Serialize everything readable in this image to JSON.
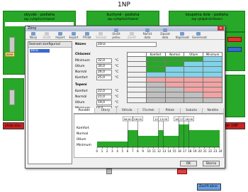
{
  "page_title": "1NP",
  "rooms": [
    {
      "title": "obyvák - podlaha",
      "status": "zap vytápění/chlazení",
      "state": "Normal"
    },
    {
      "title": "kuchyně - podlaha",
      "status": "zap vytápění/chlazení",
      "state": "Normal"
    },
    {
      "title": "koupelna dole - podlaha",
      "status": "zap vytápění/chlazení",
      "state": "Normal"
    }
  ],
  "room_button_label": "zone",
  "side_button": "program 1NP",
  "bottom_buttons": [
    "přidat zónu",
    "Zavřít okno"
  ],
  "dialog": {
    "title": "Zóny",
    "toolbar": [
      "Nový",
      "Uložit",
      "Import",
      "Export",
      "Přidat",
      "Smazat",
      "Uložit jednu",
      "Zavřít",
      "Načíst data",
      "Zapsat data",
      "Kopírovat",
      "Generovat"
    ],
    "list_header": "Seznam konfigurací",
    "list_item": "zóna",
    "name_label": "Název",
    "name_value": "zóna",
    "cooling_label": "Chlazení",
    "heating_label": "Topení",
    "fields": [
      "Minimum",
      "Útlum",
      "Normál",
      "Komfort"
    ],
    "cooling_values": [
      "32,0",
      "30,0",
      "26,0",
      "25,0"
    ],
    "heating_values": [
      "22,0",
      "21,0",
      "19,0",
      "8,0"
    ],
    "heating_fields": [
      "Komfort",
      "Normál",
      "Útlum",
      "Minimum"
    ],
    "unit": "°C",
    "grid_headers": [
      "Komfort",
      "Normal",
      "Útlum",
      "Minimum"
    ],
    "tabs": [
      "Pondělí",
      "Úterý",
      "Středa",
      "Čtvrtek",
      "Pátek",
      "Sobota",
      "Neděle"
    ],
    "schedule_labels": [
      "Komfort",
      "Normal",
      "Útlum",
      "Minimum"
    ],
    "schedule_times": [
      "06:00",
      "08:00",
      "12:00",
      "13:00",
      "16:00",
      "17:00",
      "18:00"
    ],
    "axis_hours": [
      "0",
      "1",
      "2",
      "3",
      "4",
      "5",
      "6",
      "7",
      "8",
      "9",
      "10",
      "11",
      "12",
      "13",
      "14",
      "15",
      "16",
      "17",
      "18",
      "19",
      "20",
      "21",
      "22",
      "23",
      "24"
    ],
    "ok": "OK",
    "cancel": "Storno"
  }
}
